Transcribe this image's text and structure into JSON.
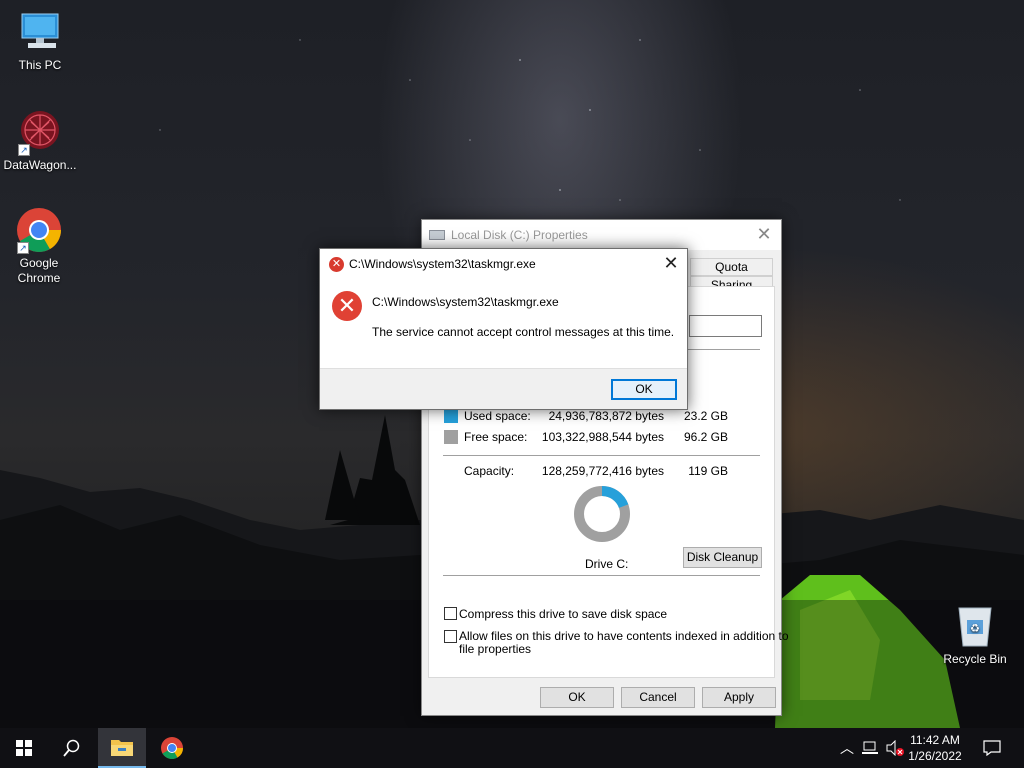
{
  "desktop": {
    "icons": [
      {
        "label": "This PC",
        "icon": "this-pc-icon"
      },
      {
        "label": "DataWagon...",
        "icon": "datawagon-icon"
      },
      {
        "label": "Google Chrome",
        "icon": "chrome-icon"
      },
      {
        "label": "Recycle Bin",
        "icon": "recycle-bin-icon"
      }
    ]
  },
  "properties_window": {
    "title": "Local Disk (C:) Properties",
    "tabs": [
      "Quota",
      "Sharing"
    ],
    "used_space": {
      "label": "Used space:",
      "bytes": "24,936,783,872 bytes",
      "size": "23.2 GB",
      "color": "#26a0da"
    },
    "free_space": {
      "label": "Free space:",
      "bytes": "103,322,988,544 bytes",
      "size": "96.2 GB",
      "color": "#a0a0a0"
    },
    "capacity": {
      "label": "Capacity:",
      "bytes": "128,259,772,416 bytes",
      "size": "119 GB"
    },
    "used_fraction": 0.194,
    "drive_label": "Drive C:",
    "disk_cleanup_label": "Disk Cleanup",
    "compress_label": "Compress this drive to save disk space",
    "index_label_line1": "Allow files on this drive to have contents indexed in addition to",
    "index_label_line2": "file properties",
    "compress_checked": false,
    "index_checked": false,
    "buttons": {
      "ok": "OK",
      "cancel": "Cancel",
      "apply": "Apply"
    }
  },
  "error_dialog": {
    "title": "C:\\Windows\\system32\\taskmgr.exe",
    "path": "C:\\Windows\\system32\\taskmgr.exe",
    "message": "The service cannot accept control messages at this time.",
    "ok_label": "OK"
  },
  "taskbar": {
    "time": "11:42 AM",
    "date": "1/26/2022"
  }
}
